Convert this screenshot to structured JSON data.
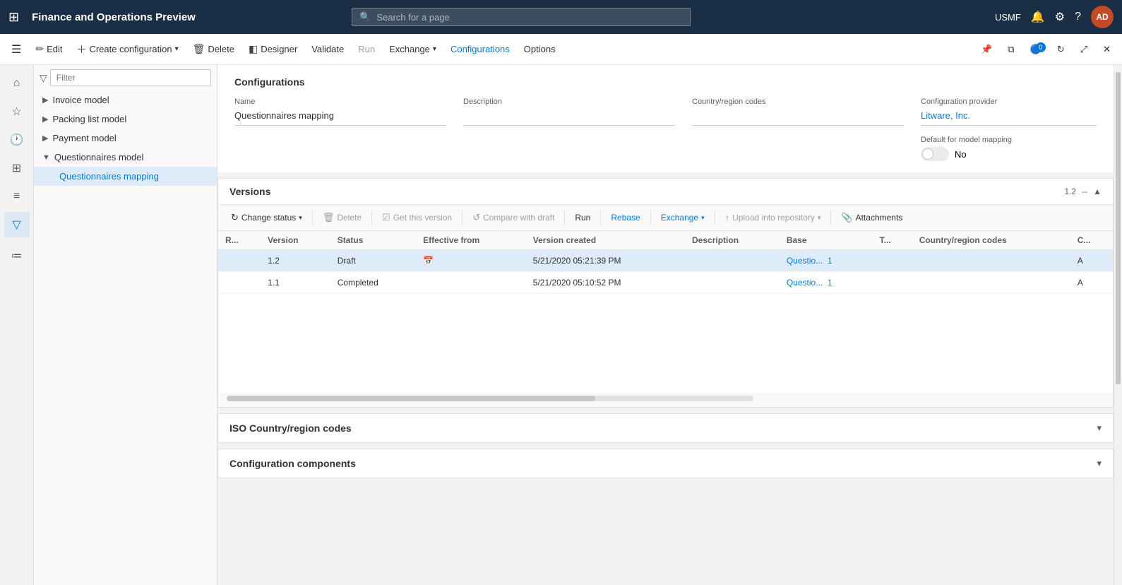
{
  "app": {
    "title": "Finance and Operations Preview",
    "search_placeholder": "Search for a page"
  },
  "nav_right": {
    "username": "USMF",
    "avatar_text": "AD"
  },
  "command_bar": {
    "edit": "Edit",
    "create_config": "Create configuration",
    "delete": "Delete",
    "designer": "Designer",
    "validate": "Validate",
    "run": "Run",
    "exchange": "Exchange",
    "configurations": "Configurations",
    "options": "Options"
  },
  "filter_placeholder": "Filter",
  "tree": {
    "items": [
      {
        "id": "invoice-model",
        "label": "Invoice model",
        "indent": 0,
        "expanded": false
      },
      {
        "id": "packing-list-model",
        "label": "Packing list model",
        "indent": 0,
        "expanded": false
      },
      {
        "id": "payment-model",
        "label": "Payment model",
        "indent": 0,
        "expanded": false
      },
      {
        "id": "questionnaires-model",
        "label": "Questionnaires model",
        "indent": 0,
        "expanded": true
      },
      {
        "id": "questionnaires-mapping",
        "label": "Questionnaires mapping",
        "indent": 1,
        "selected": true
      }
    ]
  },
  "config_section": {
    "title": "Configurations",
    "fields": {
      "name_label": "Name",
      "name_value": "Questionnaires mapping",
      "description_label": "Description",
      "description_value": "",
      "country_label": "Country/region codes",
      "country_value": "",
      "provider_label": "Configuration provider",
      "provider_value": "Litware, Inc.",
      "default_mapping_label": "Default for model mapping",
      "default_mapping_value": "No"
    }
  },
  "versions_section": {
    "title": "Versions",
    "version_label": "1.2",
    "toolbar": {
      "change_status": "Change status",
      "delete": "Delete",
      "get_this_version": "Get this version",
      "compare_with_draft": "Compare with draft",
      "run": "Run",
      "rebase": "Rebase",
      "exchange": "Exchange",
      "upload_into_repository": "Upload into repository",
      "attachments": "Attachments"
    },
    "table": {
      "columns": [
        "R...",
        "Version",
        "Status",
        "Effective from",
        "Version created",
        "Description",
        "Base",
        "T...",
        "Country/region codes",
        "C..."
      ],
      "rows": [
        {
          "r": "",
          "version": "1.2",
          "status": "Draft",
          "effective_from": "",
          "version_created": "5/21/2020 05:21:39 PM",
          "description": "",
          "base": "Questio...",
          "base_num": "1",
          "t": "",
          "country": "",
          "c": "A",
          "selected": true
        },
        {
          "r": "",
          "version": "1.1",
          "status": "Completed",
          "effective_from": "",
          "version_created": "5/21/2020 05:10:52 PM",
          "description": "",
          "base": "Questio...",
          "base_num": "1",
          "t": "",
          "country": "",
          "c": "A",
          "selected": false
        }
      ]
    }
  },
  "iso_section": {
    "title": "ISO Country/region codes"
  },
  "config_components_section": {
    "title": "Configuration components"
  }
}
